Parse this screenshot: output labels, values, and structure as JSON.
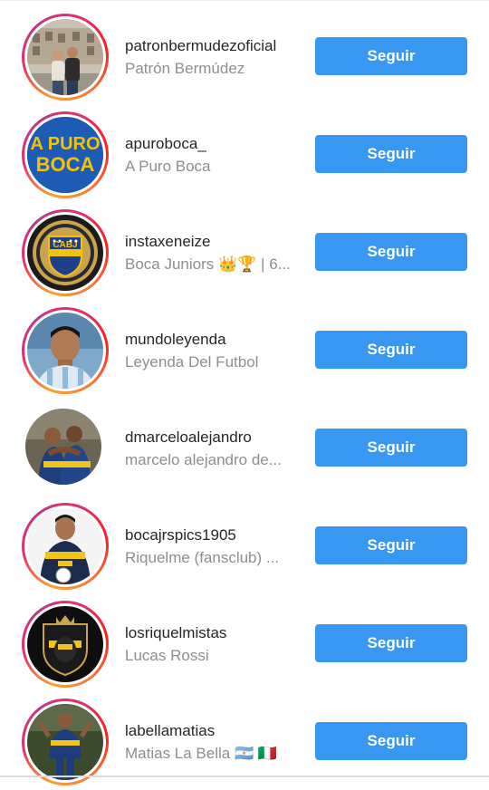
{
  "accent_color": "#3897f0",
  "suggestions": [
    {
      "username": "patronbermudezoficial",
      "full_name": "Patrón Bermúdez",
      "button_label": "Seguir",
      "has_story_ring": true,
      "avatar": "couple-photo-avatar"
    },
    {
      "username": "apuroboca_",
      "full_name": "A Puro Boca",
      "button_label": "Seguir",
      "has_story_ring": true,
      "avatar": "a-puro-boca-logo-avatar"
    },
    {
      "username": "instaxeneize",
      "full_name": "Boca Juniors 👑🏆 | 6...",
      "button_label": "Seguir",
      "has_story_ring": true,
      "avatar": "cabj-crest-avatar"
    },
    {
      "username": "mundoleyenda",
      "full_name": "Leyenda  Del Futbol",
      "button_label": "Seguir",
      "has_story_ring": true,
      "avatar": "player-portrait-avatar"
    },
    {
      "username": "dmarceloalejandro",
      "full_name": "marcelo alejandro de...",
      "button_label": "Seguir",
      "has_story_ring": false,
      "avatar": "players-hug-avatar"
    },
    {
      "username": "bocajrspics1905",
      "full_name": "Riquelme (fansclub) ...",
      "button_label": "Seguir",
      "has_story_ring": true,
      "avatar": "player-jersey-avatar"
    },
    {
      "username": "losriquelmistas",
      "full_name": "Lucas Rossi",
      "button_label": "Seguir",
      "has_story_ring": true,
      "avatar": "riquelmistas-badge-avatar"
    },
    {
      "username": "labellamatias",
      "full_name": "Matias La Bella 🇦🇷 🇮🇹",
      "button_label": "Seguir",
      "has_story_ring": true,
      "avatar": "stadium-player-avatar"
    }
  ]
}
